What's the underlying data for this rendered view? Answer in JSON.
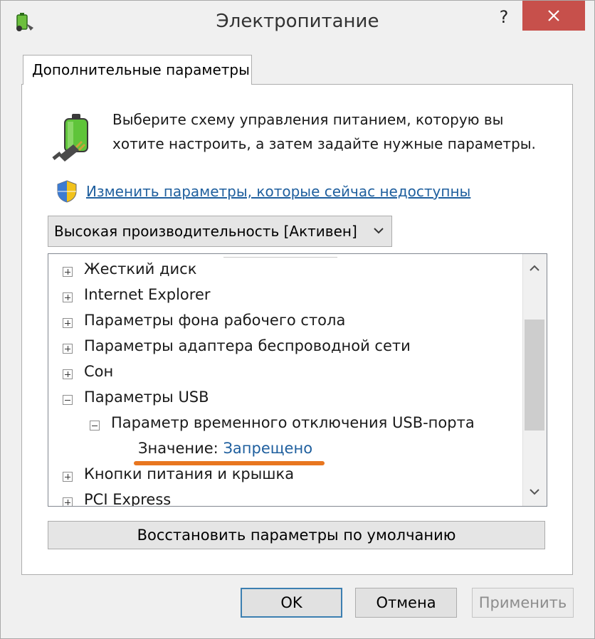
{
  "window": {
    "title": "Электропитание",
    "help_label": "?"
  },
  "tab": {
    "label": "Дополнительные параметры"
  },
  "intro": {
    "line1": "Выберите схему управления питанием, которую вы",
    "line2": "хотите настроить, а затем задайте нужные параметры."
  },
  "link": {
    "label": "Изменить параметры, которые сейчас недоступны"
  },
  "plan_select": {
    "value": "Высокая производительность [Активен]"
  },
  "tree": {
    "items": [
      {
        "label": "Жесткий диск",
        "state": "collapsed"
      },
      {
        "label": "Internet Explorer",
        "state": "collapsed"
      },
      {
        "label": "Параметры фона рабочего стола",
        "state": "collapsed"
      },
      {
        "label": "Параметры адаптера беспроводной сети",
        "state": "collapsed"
      },
      {
        "label": "Сон",
        "state": "collapsed"
      },
      {
        "label": "Параметры USB",
        "state": "expanded"
      },
      {
        "label": "Параметр временного отключения USB-порта",
        "state": "expanded"
      },
      {
        "label": "Кнопки питания и крышка",
        "state": "collapsed"
      },
      {
        "label": "PCI Express",
        "state": "collapsed"
      }
    ],
    "value_label": "Значение:",
    "value": "Запрещено"
  },
  "buttons": {
    "restore": "Восстановить параметры по умолчанию",
    "ok": "OK",
    "cancel": "Отмена",
    "apply": "Применить"
  },
  "colors": {
    "link": "#1f5f9e",
    "highlight_underline": "#e8761f",
    "close_button": "#c7504b"
  }
}
